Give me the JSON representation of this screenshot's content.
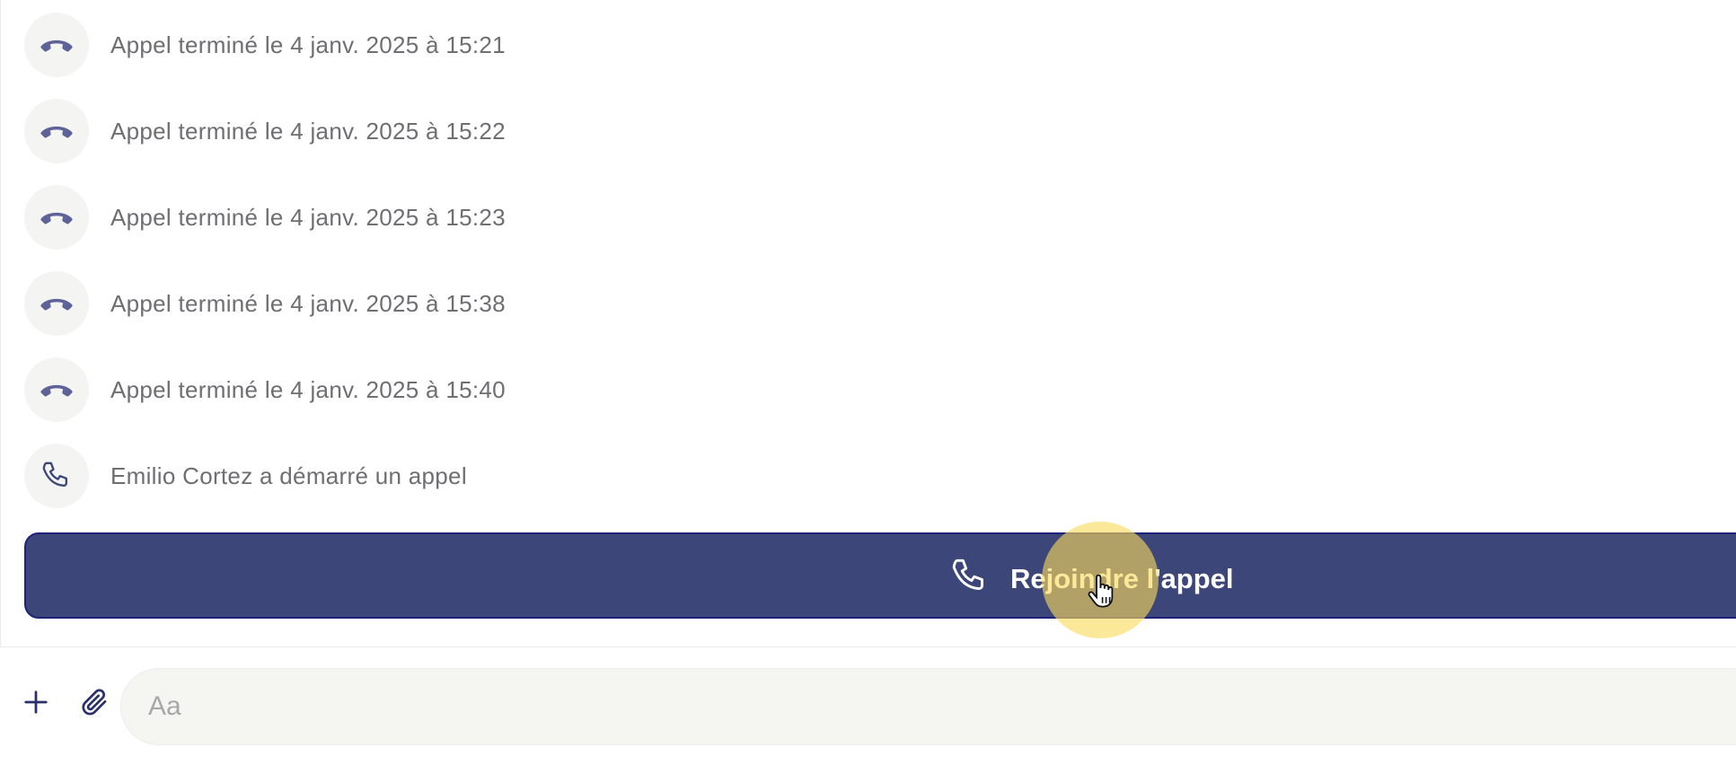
{
  "events": [
    {
      "type": "ended",
      "icon": "call-ended-icon",
      "text": "Appel terminé le 4 janv. 2025 à 15:21"
    },
    {
      "type": "ended",
      "icon": "call-ended-icon",
      "text": "Appel terminé le 4 janv. 2025 à 15:22"
    },
    {
      "type": "ended",
      "icon": "call-ended-icon",
      "text": "Appel terminé le 4 janv. 2025 à 15:23"
    },
    {
      "type": "ended",
      "icon": "call-ended-icon",
      "text": "Appel terminé le 4 janv. 2025 à 15:38"
    },
    {
      "type": "ended",
      "icon": "call-ended-icon",
      "text": "Appel terminé le 4 janv. 2025 à 15:40"
    },
    {
      "type": "started",
      "icon": "phone-icon",
      "text": "Emilio Cortez a démarré un appel"
    }
  ],
  "join_button": {
    "label": "Rejoindre l'appel",
    "icon": "phone-icon"
  },
  "composer": {
    "add_icon": "plus-icon",
    "attach_icon": "paperclip-icon",
    "placeholder": "Aa"
  },
  "colors": {
    "button_bg": "#3d4679",
    "button_border": "#1e237a",
    "icon_ended": "#5d6396",
    "icon_phone": "#3d4679",
    "event_text": "#6e6e73",
    "cursor_highlight": "#fada5a"
  }
}
